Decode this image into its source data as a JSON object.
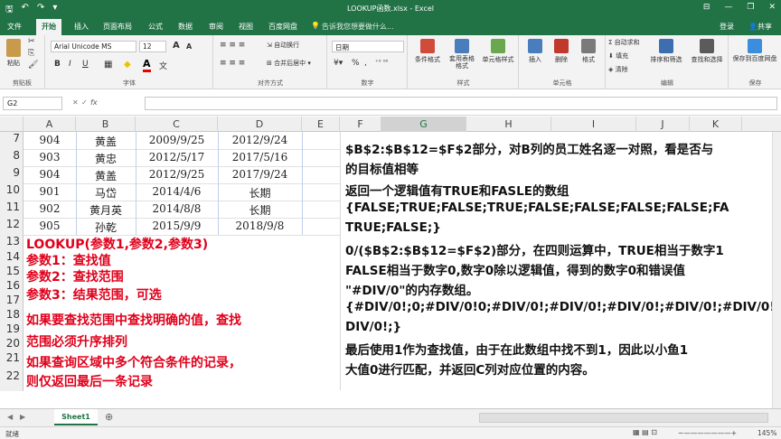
{
  "window": {
    "title": "LOOKUP函数.xlsx - Excel",
    "min": "—",
    "restore": "❐",
    "close": "✕",
    "restore_ribbon": "⊟"
  },
  "quick_access": {
    "save": "🖫",
    "undo": "↶",
    "redo": "↷",
    "more": "▾"
  },
  "menu": {
    "tabs": [
      "文件",
      "开始",
      "插入",
      "页面布局",
      "公式",
      "数据",
      "审阅",
      "视图",
      "百度网盘"
    ],
    "active": "开始",
    "tell_me": "告诉我您想要做什么...",
    "signin": "登录",
    "share": "共享"
  },
  "ribbon": {
    "clipboard": {
      "paste": "粘贴",
      "cut": "✂",
      "copy": "⎘",
      "painter": "🖌",
      "label": "剪贴板"
    },
    "font": {
      "name": "Arial Unicode MS",
      "size": "12",
      "bold": "B",
      "italic": "I",
      "underline": "U",
      "label": "字体",
      "grow": "A",
      "shrink": "A"
    },
    "align": {
      "wrap": "自动换行",
      "merge": "合并后居中",
      "label": "对齐方式"
    },
    "number": {
      "format": "日期",
      "label": "数字",
      "percent": "%",
      "comma": ","
    },
    "styles": {
      "cond": "条件格式",
      "table": "套用表格格式",
      "cell": "单元格样式",
      "label": "样式"
    },
    "cells": {
      "insert": "插入",
      "delete": "删除",
      "format": "格式",
      "label": "单元格"
    },
    "edit": {
      "autosum": "自动求和",
      "fill": "填充",
      "clear": "清除",
      "sort": "排序和筛选",
      "find": "查找和选择",
      "label": "编辑"
    },
    "save": {
      "save_baidu": "保存到百度网盘",
      "label": "保存"
    }
  },
  "formula_bar": {
    "name_box": "G2",
    "fx": "fx",
    "cancel": "✕",
    "confirm": "✓"
  },
  "columns": [
    "A",
    "B",
    "C",
    "D",
    "E",
    "F",
    "G",
    "H",
    "I",
    "J",
    "K"
  ],
  "rows": [
    {
      "n": "7",
      "a": "904",
      "b": "黄盖",
      "c": "2009/9/25",
      "d": "2012/9/24"
    },
    {
      "n": "8",
      "a": "903",
      "b": "黄忠",
      "c": "2012/5/17",
      "d": "2017/5/16"
    },
    {
      "n": "9",
      "a": "904",
      "b": "黄盖",
      "c": "2012/9/25",
      "d": "2017/9/24"
    },
    {
      "n": "10",
      "a": "901",
      "b": "马岱",
      "c": "2014/4/6",
      "d": "长期"
    },
    {
      "n": "11",
      "a": "902",
      "b": "黄月英",
      "c": "2014/8/8",
      "d": "长期"
    },
    {
      "n": "12",
      "a": "905",
      "b": "孙乾",
      "c": "2015/9/9",
      "d": "2018/9/8"
    }
  ],
  "empty_rows": [
    "13",
    "14",
    "15",
    "16",
    "17",
    "18",
    "19",
    "20",
    "21",
    "22"
  ],
  "notes": [
    "LOOKUP(参数1,参数2,参数3)",
    "参数1：查找值",
    "参数2：查找范围",
    "参数3：结果范围，可选",
    "如果要查找范围中查找明确的值，查找",
    "范围必须升序排列",
    "如果查询区域中多个符合条件的记录，",
    "则仅返回最后一条记录"
  ],
  "explain": [
    "$B$2:$B$12=$F$2部分，对B列的员工姓名逐一对照，看是否与",
    "的目标值相等",
    "返回一个逻辑值有TRUE和FASLE的数组",
    "{FALSE;TRUE;FALSE;TRUE;FALSE;FALSE;FALSE;FALSE;FA",
    "TRUE;FALSE;}",
    "0/($B$2:$B$12=$F$2)部分，在四则运算中，TRUE相当于数字1",
    "FALSE相当于数字0,数字0除以逻辑值，得到的数字0和错误值",
    "\"#DIV/0\"的内存数组。",
    "{#DIV/0!;0;#DIV/0!0;#DIV/0!;#DIV/0!;#DIV/0!;#DIV/0!;#DIV/0!",
    "DIV/0!;}",
    "最后使用1作为查找值，由于在此数组中找不到1，因此以小鱼1",
    "大值0进行匹配，并返回C列对应位置的内容。"
  ],
  "sheet": {
    "tab": "Sheet1",
    "add": "⊕"
  },
  "status": {
    "ready": "就绪",
    "zoom": "145%"
  },
  "colors": {
    "excel_green": "#217346",
    "note_red": "#e0001b"
  }
}
